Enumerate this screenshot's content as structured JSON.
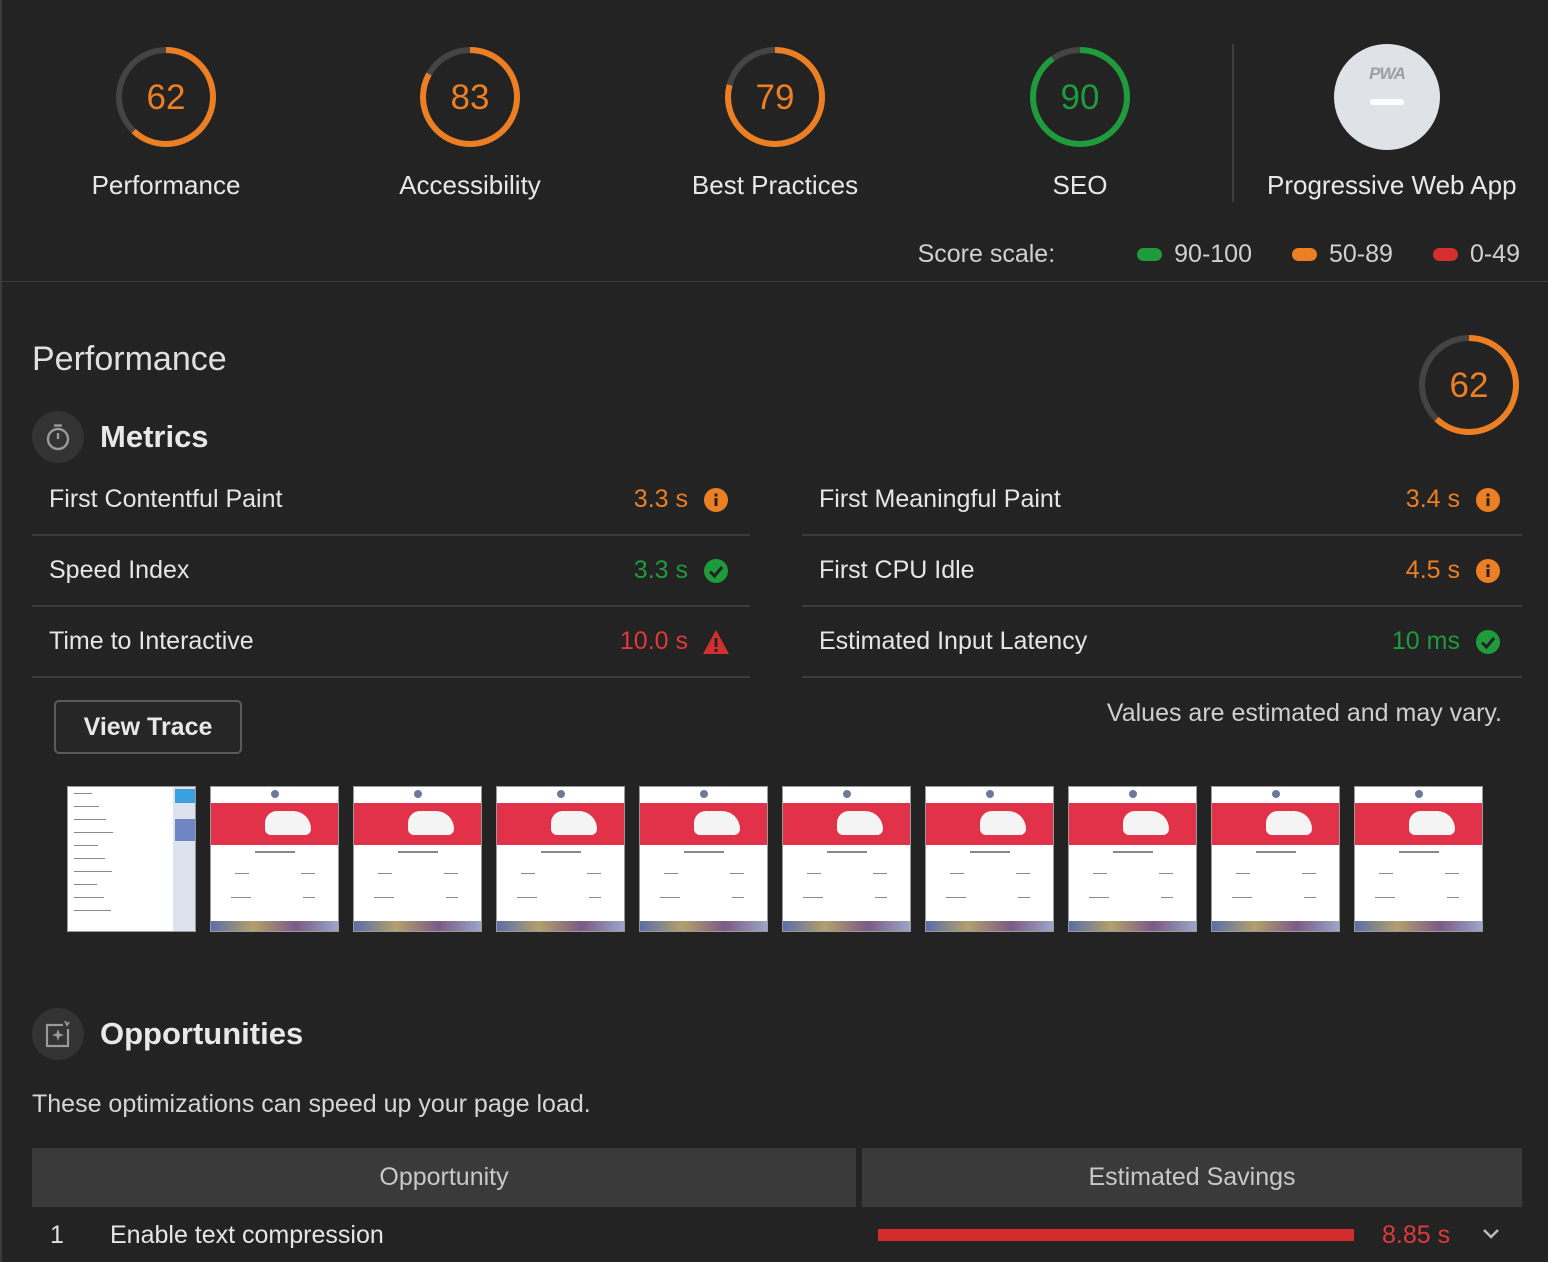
{
  "colors": {
    "orange": "#ec7f23",
    "green": "#1e9b3a",
    "red": "#e1383a",
    "track": "#444444"
  },
  "gauges": [
    {
      "score": "62",
      "label": "Performance",
      "fraction": 0.62,
      "color": "#ec7f23"
    },
    {
      "score": "83",
      "label": "Accessibility",
      "fraction": 0.83,
      "color": "#ec7f23"
    },
    {
      "score": "79",
      "label": "Best Practices",
      "fraction": 0.79,
      "color": "#ec7f23"
    },
    {
      "score": "90",
      "label": "SEO",
      "fraction": 0.9,
      "color": "#1e9b3a"
    }
  ],
  "pwa": {
    "badge_text": "PWA",
    "label": "Progressive Web App"
  },
  "score_scale": {
    "label": "Score scale:",
    "ranges": [
      {
        "text": "90-100",
        "color": "#1e9b3a"
      },
      {
        "text": "50-89",
        "color": "#ec7f23"
      },
      {
        "text": "0-49",
        "color": "#e1383a"
      }
    ]
  },
  "performance": {
    "title": "Performance",
    "score": "62",
    "fraction": 0.62
  },
  "metrics": {
    "title": "Metrics",
    "icon": "stopwatch-icon",
    "items": [
      {
        "name": "First Contentful Paint",
        "value": "3.3 s",
        "status": "average",
        "icon": "info-icon"
      },
      {
        "name": "First Meaningful Paint",
        "value": "3.4 s",
        "status": "average",
        "icon": "info-icon"
      },
      {
        "name": "Speed Index",
        "value": "3.3 s",
        "status": "pass",
        "icon": "check-icon"
      },
      {
        "name": "First CPU Idle",
        "value": "4.5 s",
        "status": "average",
        "icon": "info-icon"
      },
      {
        "name": "Time to Interactive",
        "value": "10.0 s",
        "status": "fail",
        "icon": "warning-icon"
      },
      {
        "name": "Estimated Input Latency",
        "value": "10 ms",
        "status": "pass",
        "icon": "check-icon"
      }
    ],
    "view_trace": "View Trace",
    "note": "Values are estimated and may vary."
  },
  "filmstrip": {
    "count": 10
  },
  "opportunities": {
    "title": "Opportunities",
    "icon": "opportunity-icon",
    "description": "These optimizations can speed up your page load.",
    "col_opportunity": "Opportunity",
    "col_savings": "Estimated Savings",
    "rows": [
      {
        "index": "1",
        "name": "Enable text compression",
        "savings": "8.85 s",
        "bar_fraction": 1.0
      }
    ]
  }
}
